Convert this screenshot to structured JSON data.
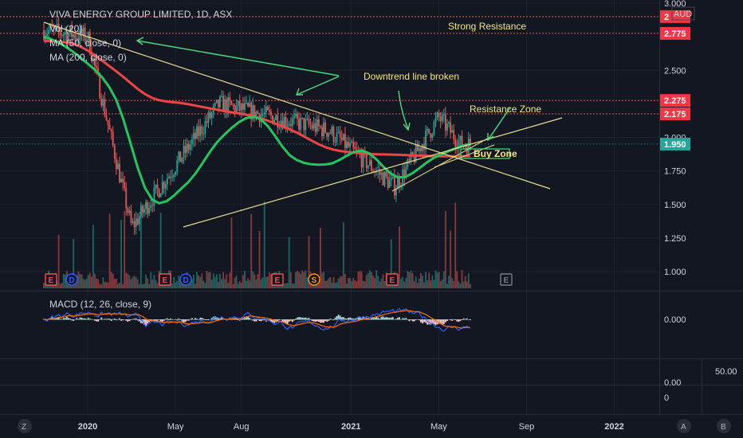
{
  "header": {
    "symbol_title": "VIVA ENERGY GROUP LIMITED, 1D, ASX",
    "currency": "AUD"
  },
  "legend": {
    "vol": "Vol (20)",
    "ma50": "MA (50, close, 0)",
    "ma200": "MA (200, close, 0)",
    "macd": "MACD (12, 26, close, 9)"
  },
  "colors": {
    "background": "#131722",
    "up": "#26a69a",
    "down": "#ef5350",
    "ma50": "#22c55e",
    "ma200": "#ef4444",
    "trendline": "#e8dd8c",
    "resistance": "#ef5350",
    "annotation": "#f5e67b",
    "green_arrow": "#4ade80",
    "macd": "#2962ff",
    "signal": "#ff6d00"
  },
  "annotations": {
    "strong_resistance": "Strong Resistance",
    "downtrend_broken": "Downtrend line broken",
    "resistance_zone": "Resistance Zone",
    "buy_zone": "Buy Zone"
  },
  "price_axis": {
    "ticks": [
      "3.000",
      "2.500",
      "2.000",
      "1.750",
      "1.500",
      "1.250",
      "1.000"
    ],
    "badges": [
      {
        "label": "2",
        "value": 2.9
      },
      {
        "label": "2.775",
        "value": 2.775
      },
      {
        "label": "2.275",
        "value": 2.275
      },
      {
        "label": "2.175",
        "value": 2.175
      },
      {
        "label": "1.950",
        "value": 1.95
      }
    ]
  },
  "macd_axis": {
    "ticks": [
      "0.000"
    ]
  },
  "lower_axis": {
    "ticks": [
      "50.00",
      "0.00",
      "0"
    ]
  },
  "time_axis": {
    "ticks": [
      {
        "label": "2020",
        "bold": true
      },
      {
        "label": "May",
        "bold": false
      },
      {
        "label": "Aug",
        "bold": false
      },
      {
        "label": "2021",
        "bold": true
      },
      {
        "label": "May",
        "bold": false
      },
      {
        "label": "Sep",
        "bold": false
      },
      {
        "label": "2022",
        "bold": true
      }
    ]
  },
  "events": {
    "earnings": "E",
    "dividend": "D",
    "split": "S"
  },
  "corner_buttons": {
    "left": "Z",
    "right_a": "A",
    "right_b": "B"
  },
  "chart_data": [
    {
      "type": "candlestick",
      "title": "VIVA ENERGY GROUP LIMITED, 1D, ASX",
      "x_range": [
        "2019-11",
        "2022-02"
      ],
      "ylim": [
        0.9,
        3.0
      ],
      "support_resistance": [
        2.775,
        2.275,
        2.175
      ],
      "last_price": 1.95,
      "key_levels": [
        {
          "date": "2019-11",
          "price": 2.8
        },
        {
          "date": "2020-01",
          "price": 2.75
        },
        {
          "date": "2020-03",
          "price": 1.33
        },
        {
          "date": "2020-07",
          "price": 2.25
        },
        {
          "date": "2020-12",
          "price": 2.05
        },
        {
          "date": "2021-03",
          "price": 1.63
        },
        {
          "date": "2021-05",
          "price": 2.15
        },
        {
          "date": "2021-06",
          "price": 1.95
        }
      ],
      "series": [
        {
          "name": "MA (50, close, 0)",
          "values": [
            2.75,
            2.6,
            2.3,
            1.55,
            1.65,
            2.0,
            2.15,
            1.85,
            1.8,
            1.9,
            1.7,
            1.85,
            1.95
          ]
        },
        {
          "name": "MA (200, close, 0)",
          "values": [
            2.72,
            2.68,
            2.5,
            2.3,
            2.25,
            2.2,
            2.15,
            2.05,
            1.92,
            1.88,
            1.87,
            1.86,
            1.86
          ]
        }
      ]
    },
    {
      "type": "bar",
      "title": "Vol (20)"
    },
    {
      "type": "line",
      "title": "MACD (12, 26, close, 9)"
    }
  ]
}
